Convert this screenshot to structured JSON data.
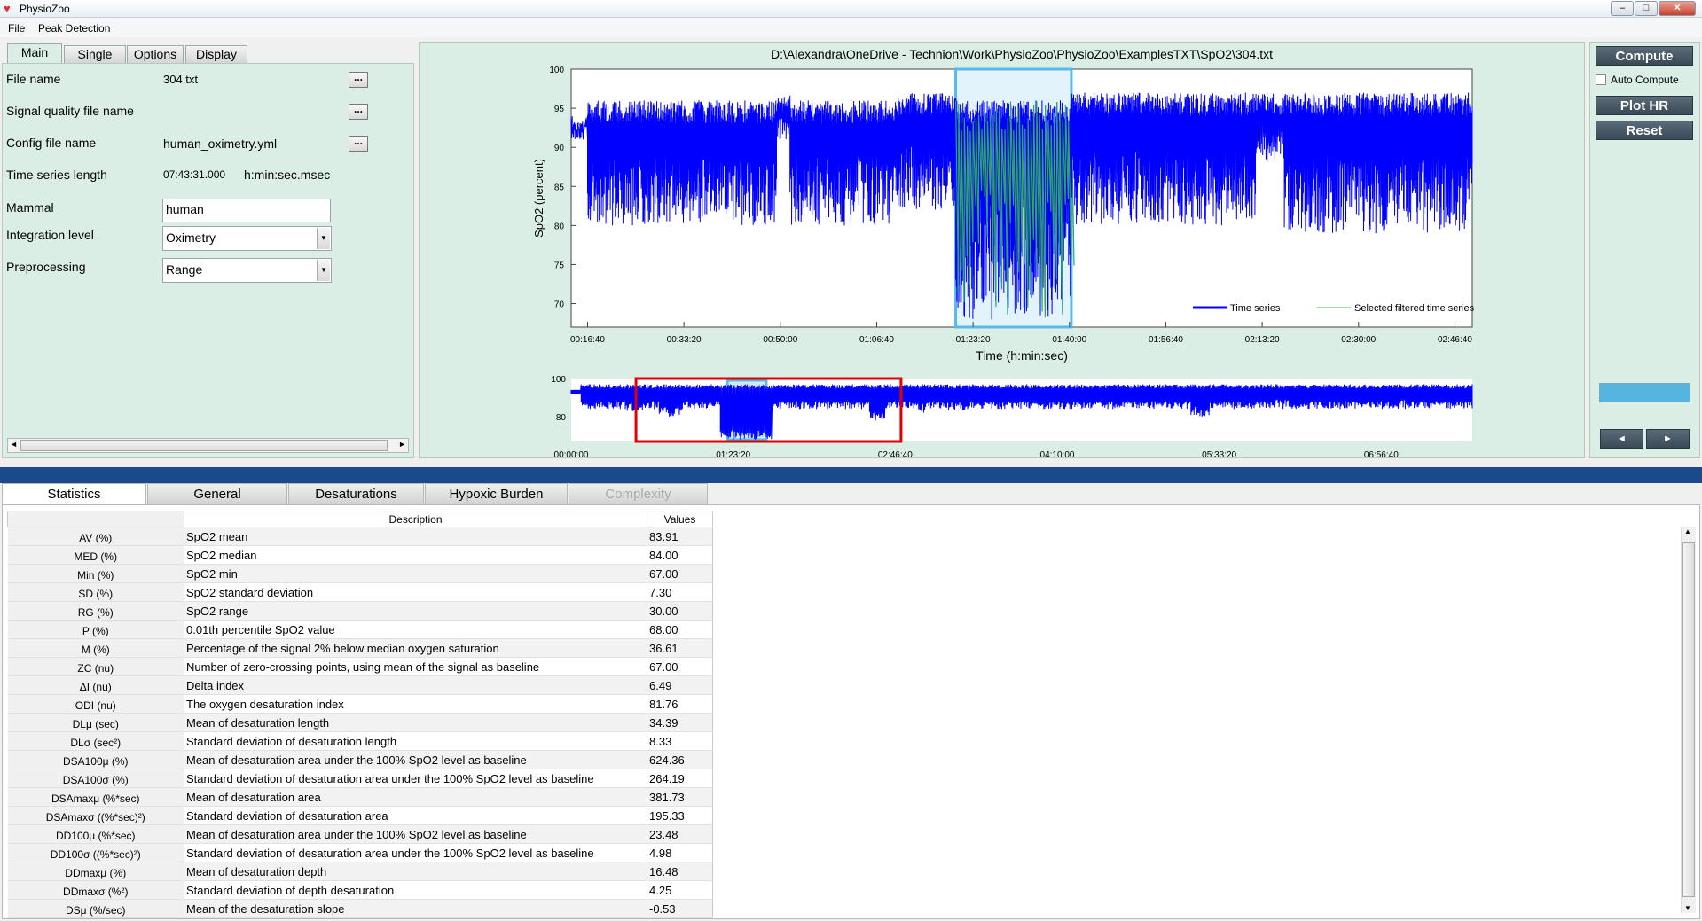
{
  "window": {
    "title": "PhysioZoo"
  },
  "menu": [
    "File",
    "Peak Detection"
  ],
  "left_tabs": [
    "Main",
    "Single",
    "Options",
    "Display"
  ],
  "fields": {
    "file_name_label": "File name",
    "file_name_value": "304.txt",
    "signal_quality_label": "Signal quality file name",
    "config_label": "Config file name",
    "config_value": "human_oximetry.yml",
    "ts_length_label": "Time series length",
    "ts_length_value": "07:43:31.000",
    "ts_length_unit": "h:min:sec.msec",
    "mammal_label": "Mammal",
    "mammal_value": "human",
    "integration_label": "Integration level",
    "integration_value": "Oximetry",
    "preprocessing_label": "Preprocessing",
    "preprocessing_value": "Range",
    "browse_label": "..."
  },
  "right_controls": {
    "compute": "Compute",
    "auto_compute": "Auto Compute",
    "plot_hr": "Plot HR",
    "reset": "Reset",
    "prev": "◄",
    "next": "►"
  },
  "chart_data": [
    {
      "type": "line",
      "title": "D:\\Alexandra\\OneDrive - Technion\\Work\\PhysioZoo\\PhysioZoo\\ExamplesTXT\\SpO2\\304.txt",
      "xlabel": "Time (h:min:sec)",
      "ylabel": "SpO2 (percent)",
      "ylim": [
        67,
        100
      ],
      "yticks": [
        100,
        95,
        90,
        85,
        80,
        75,
        70
      ],
      "xticks": [
        "00:16:40",
        "00:33:20",
        "00:50:00",
        "01:06:40",
        "01:23:20",
        "01:40:00",
        "01:56:40",
        "02:13:20",
        "02:30:00",
        "02:46:40"
      ],
      "xlim_sec": [
        830,
        10180
      ],
      "selection_sec": [
        4820,
        6020
      ],
      "legend": [
        "Time series",
        "Selected filtered time series"
      ],
      "legend_position": "bottom-right",
      "colors": {
        "series": "#0000ff",
        "filtered": "#2ea36a",
        "selection": "#59b9e8"
      },
      "series": [
        {
          "name": "Time series",
          "segments": [
            {
              "start": 830,
              "end": 1000,
              "hi": 94,
              "lo": 92
            },
            {
              "start": 1000,
              "end": 2960,
              "hi": 96,
              "lo": 80
            },
            {
              "start": 2960,
              "end": 3100,
              "hi": 97,
              "lo": 91
            },
            {
              "start": 3100,
              "end": 4200,
              "hi": 96,
              "lo": 80
            },
            {
              "start": 4200,
              "end": 4820,
              "hi": 97,
              "lo": 82
            },
            {
              "start": 4820,
              "end": 6020,
              "hi": 96,
              "lo": 68
            },
            {
              "start": 6020,
              "end": 7930,
              "hi": 97,
              "lo": 80
            },
            {
              "start": 7930,
              "end": 8230,
              "hi": 97,
              "lo": 88
            },
            {
              "start": 8230,
              "end": 10180,
              "hi": 97,
              "lo": 79
            }
          ]
        }
      ]
    },
    {
      "type": "line",
      "title": "",
      "ylim": [
        67,
        100
      ],
      "yticks": [
        100,
        80
      ],
      "xticks": [
        "00:00:00",
        "01:23:20",
        "02:46:40",
        "04:10:00",
        "05:33:20",
        "06:56:40"
      ],
      "xlim_sec": [
        0,
        27811
      ],
      "window_sec": [
        2000,
        10180
      ],
      "selection_sec": [
        4820,
        6020
      ],
      "colors": {
        "series": "#0000ff",
        "window": "#e00000",
        "selection": "#59b9e8"
      }
    }
  ],
  "bottom_tabs": [
    "Statistics",
    "General",
    "Desaturations",
    "Hypoxic Burden",
    "Complexity"
  ],
  "table": {
    "headers": [
      "Description",
      "Values"
    ],
    "rows": [
      [
        "AV (%)",
        "SpO2 mean",
        "83.91"
      ],
      [
        "MED (%)",
        "SpO2 median",
        "84.00"
      ],
      [
        "Min (%)",
        "SpO2 min",
        "67.00"
      ],
      [
        "SD (%)",
        "SpO2 standard deviation",
        "7.30"
      ],
      [
        "RG (%)",
        "SpO2 range",
        "30.00"
      ],
      [
        "P (%)",
        "0.01th percentile SpO2 value",
        "68.00"
      ],
      [
        "M (%)",
        "Percentage of the signal 2% below median oxygen saturation",
        "36.61"
      ],
      [
        "ZC (nu)",
        "Number of zero-crossing points, using mean of the signal as baseline",
        "67.00"
      ],
      [
        "ΔI (nu)",
        "Delta index",
        "6.49"
      ],
      [
        "ODI (nu)",
        "The oxygen desaturation index",
        "81.76"
      ],
      [
        "DLμ (sec)",
        "Mean of desaturation length",
        "34.39"
      ],
      [
        "DLσ (sec²)",
        "Standard deviation of desaturation length",
        "8.33"
      ],
      [
        "DSA100μ (%)",
        "Mean of desaturation area under the 100% SpO2 level as baseline",
        "624.36"
      ],
      [
        "DSA100σ (%)",
        "Standard deviation of desaturation area under the 100% SpO2 level as baseline",
        "264.19"
      ],
      [
        "DSAmaxμ (%*sec)",
        "Mean of desaturation area",
        "381.73"
      ],
      [
        "DSAmaxσ ((%*sec)²)",
        "Standard deviation of desaturation area",
        "195.33"
      ],
      [
        "DD100μ (%*sec)",
        "Mean of desaturation area under the 100% SpO2 level as baseline",
        "23.48"
      ],
      [
        "DD100σ ((%*sec)²)",
        "Standard deviation of desaturation area under the 100% SpO2 level as baseline",
        "4.98"
      ],
      [
        "DDmaxμ (%)",
        "Mean of desaturation depth",
        "16.48"
      ],
      [
        "DDmaxσ (%²)",
        "Standard deviation of depth desaturation",
        "4.25"
      ],
      [
        "DSμ (%/sec)",
        "Mean of the desaturation slope",
        "-0.53"
      ]
    ]
  }
}
